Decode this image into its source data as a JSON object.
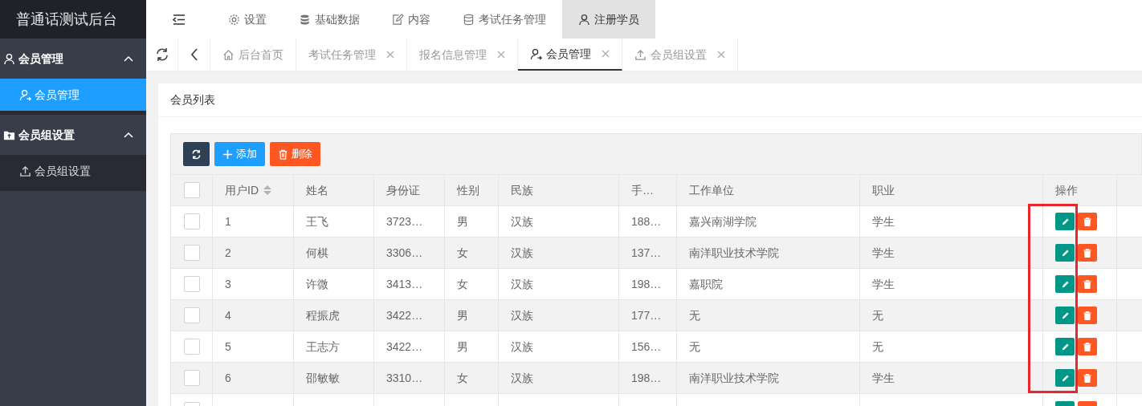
{
  "logo": "普通话测试后台",
  "top_nav": [
    {
      "kind": "gear",
      "label": "设置",
      "selected": false
    },
    {
      "kind": "database",
      "label": "基础数据",
      "selected": false
    },
    {
      "kind": "edit",
      "label": "内容",
      "selected": false
    },
    {
      "kind": "database-outline",
      "label": "考试任务管理",
      "selected": false
    },
    {
      "kind": "user",
      "label": "注册学员",
      "selected": true
    }
  ],
  "sidebar": {
    "groups": [
      {
        "kind": "user",
        "label": "会员管理",
        "expanded": true,
        "items": [
          {
            "kind": "user-plus",
            "label": "会员管理",
            "selected": true
          }
        ]
      },
      {
        "kind": "folder",
        "label": "会员组设置",
        "expanded": true,
        "items": [
          {
            "kind": "upload",
            "label": "会员组设置",
            "selected": false
          }
        ]
      }
    ]
  },
  "tabs": [
    {
      "kind": "home",
      "label": "后台首页",
      "closable": false,
      "selected": false
    },
    {
      "label": "考试任务管理",
      "closable": true,
      "selected": false
    },
    {
      "label": "报名信息管理",
      "closable": true,
      "selected": false
    },
    {
      "kind": "user-plus",
      "label": "会员管理",
      "closable": true,
      "selected": true
    },
    {
      "kind": "upload",
      "label": "会员组设置",
      "closable": true,
      "selected": false
    }
  ],
  "card": {
    "title": "会员列表"
  },
  "toolbar": [
    {
      "kind": "refresh"
    },
    {
      "kind": "add",
      "label": "添加"
    },
    {
      "kind": "delete",
      "label": "删除"
    }
  ],
  "table": {
    "header_checked": false,
    "columns": [
      {
        "label": "用户ID",
        "sortable": true
      },
      {
        "label": "姓名",
        "sortable": false
      },
      {
        "label": "身份证",
        "sortable": false
      },
      {
        "label": "性别",
        "sortable": false
      },
      {
        "label": "民族",
        "sortable": false
      },
      {
        "label": "手…",
        "sortable": false
      },
      {
        "label": "工作单位",
        "sortable": false
      },
      {
        "label": "职业",
        "sortable": false
      },
      {
        "label": "操作",
        "sortable": false
      }
    ],
    "rows": [
      {
        "checked": false,
        "cells": [
          "1",
          "王飞",
          "3723…",
          "男",
          "汉族",
          "188…",
          "嘉兴南湖学院",
          "学生"
        ]
      },
      {
        "checked": false,
        "cells": [
          "2",
          "何棋",
          "3306…",
          "女",
          "汉族",
          "137…",
          "南洋职业技术学院",
          "学生"
        ]
      },
      {
        "checked": false,
        "cells": [
          "3",
          "许微",
          "3413…",
          "女",
          "汉族",
          "198…",
          "嘉职院",
          "学生"
        ]
      },
      {
        "checked": false,
        "cells": [
          "4",
          "程振虎",
          "3422…",
          "男",
          "汉族",
          "177…",
          "无",
          "无"
        ]
      },
      {
        "checked": false,
        "cells": [
          "5",
          "王志方",
          "3422…",
          "男",
          "汉族",
          "156…",
          "无",
          "无"
        ]
      },
      {
        "checked": false,
        "cells": [
          "6",
          "邵敏敏",
          "3310…",
          "女",
          "汉族",
          "198…",
          "南洋职业技术学院",
          "学生"
        ]
      }
    ]
  },
  "annotation": {
    "kind": "highlight-frame",
    "color": "#e8262b"
  }
}
